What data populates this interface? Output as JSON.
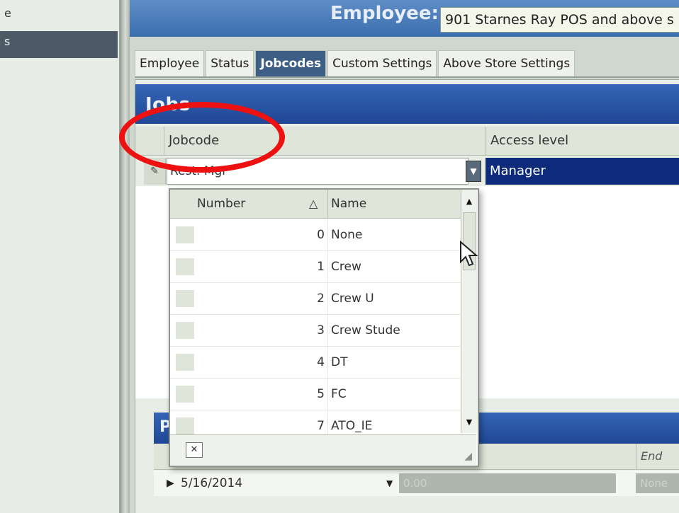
{
  "sidebar": {
    "items": [
      {
        "label": "e",
        "selected": false
      },
      {
        "label": "s",
        "selected": true
      }
    ]
  },
  "header": {
    "employee_label": "Employee:",
    "employee_value": "901 Starnes Ray POS and above s"
  },
  "tabs": [
    {
      "label": "Employee",
      "active": false
    },
    {
      "label": "Status",
      "active": false
    },
    {
      "label": "Jobcodes",
      "active": true
    },
    {
      "label": "Custom Settings",
      "active": false
    },
    {
      "label": "Above Store Settings",
      "active": false
    }
  ],
  "jobs": {
    "title": "Jobs",
    "columns": {
      "jobcode": "Jobcode",
      "access_level": "Access level"
    },
    "row": {
      "jobcode": "Rest. Mgr",
      "access_level": "Manager"
    }
  },
  "dropdown": {
    "columns": {
      "number": "Number",
      "sort_indicator": "△",
      "name": "Name"
    },
    "items": [
      {
        "number": "0",
        "name": "None"
      },
      {
        "number": "1",
        "name": "Crew"
      },
      {
        "number": "2",
        "name": "Crew U"
      },
      {
        "number": "3",
        "name": "Crew Stude"
      },
      {
        "number": "4",
        "name": "DT"
      },
      {
        "number": "5",
        "name": "FC"
      },
      {
        "number": "7",
        "name": "ATO_IE"
      }
    ],
    "clear_glyph": "✕"
  },
  "lower": {
    "title": "P",
    "end_date_label": "End date",
    "row": {
      "date": "5/16/2014",
      "amount": "0.00",
      "end": "None"
    }
  },
  "colors": {
    "accent_blue": "#1f4795",
    "selection_navy": "#0e2a7a",
    "annotation_red": "#ee1111"
  }
}
